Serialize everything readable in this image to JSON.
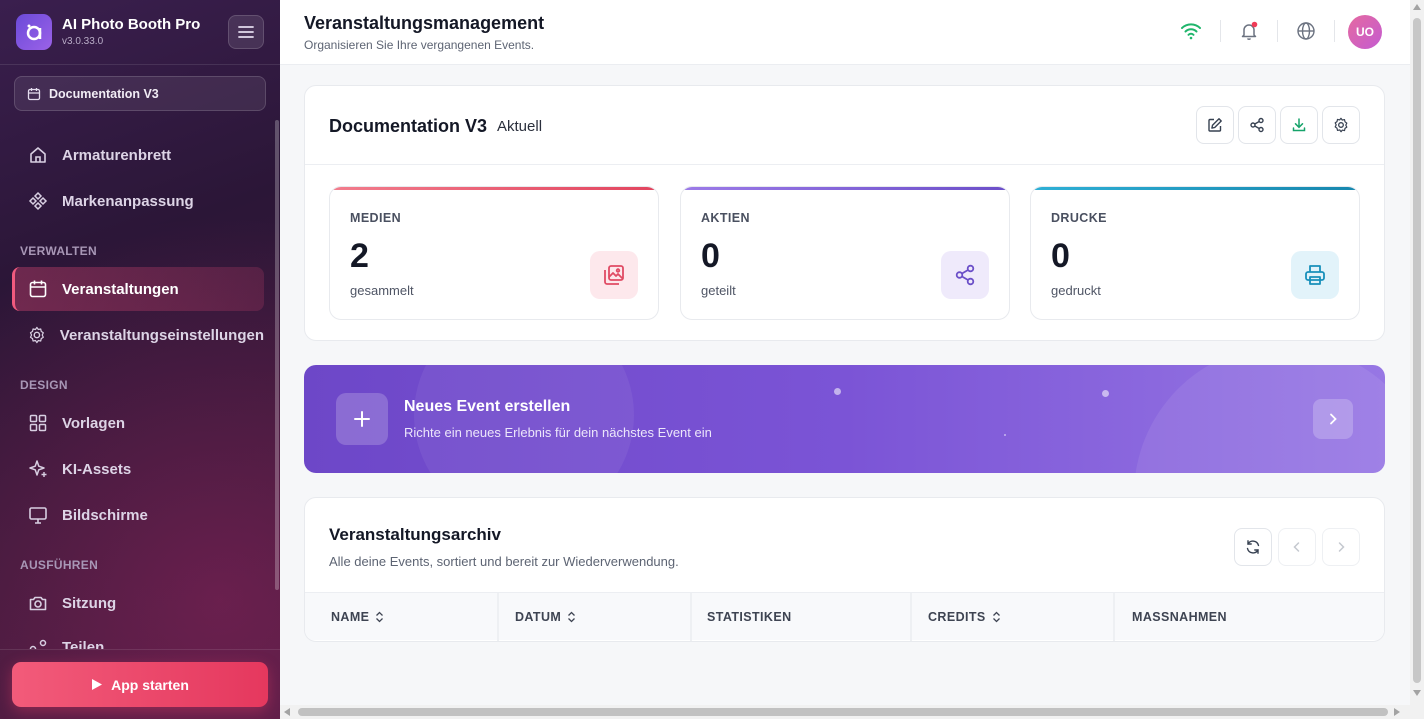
{
  "app": {
    "title": "AI Photo Booth Pro",
    "version": "v3.0.33.0"
  },
  "sidebar": {
    "event_selector": "Documentation V3",
    "items": [
      {
        "label": "Armaturenbrett",
        "icon": "home-icon"
      },
      {
        "label": "Markenanpassung",
        "icon": "brand-icon"
      },
      {
        "label": "Veranstaltungen",
        "icon": "calendar-icon",
        "active": true
      },
      {
        "label": "Veranstaltungseinstellungen",
        "icon": "gear-icon"
      },
      {
        "label": "Vorlagen",
        "icon": "grid-icon"
      },
      {
        "label": "KI-Assets",
        "icon": "sparkle-icon"
      },
      {
        "label": "Bildschirme",
        "icon": "monitor-icon"
      },
      {
        "label": "Sitzung",
        "icon": "camera-icon"
      },
      {
        "label": "Teilen",
        "icon": "share-icon"
      }
    ],
    "sections": {
      "manage": "VERWALTEN",
      "design": "DESIGN",
      "run": "AUSFÜHREN"
    },
    "start_button": "App starten"
  },
  "header": {
    "title": "Veranstaltungsmanagement",
    "subtitle": "Organisieren Sie Ihre vergangenen Events.",
    "avatar": "UO"
  },
  "event": {
    "name": "Documentation V3",
    "status": "Aktuell",
    "stats": [
      {
        "label": "MEDIEN",
        "value": "2",
        "sub": "gesammelt",
        "color": "#e8576f"
      },
      {
        "label": "AKTIEN",
        "value": "0",
        "sub": "geteilt",
        "color": "#7b5cd6"
      },
      {
        "label": "DRUCKE",
        "value": "0",
        "sub": "gedruckt",
        "color": "#1d9ac0"
      }
    ]
  },
  "banner": {
    "title": "Neues Event erstellen",
    "subtitle": "Richte ein neues Erlebnis für dein nächstes Event ein"
  },
  "archive": {
    "title": "Veranstaltungsarchiv",
    "subtitle": "Alle deine Events, sortiert und bereit zur Wiederverwendung.",
    "columns": [
      "NAME",
      "DATUM",
      "STATISTIKEN",
      "CREDITS",
      "MASSNAHMEN"
    ]
  }
}
